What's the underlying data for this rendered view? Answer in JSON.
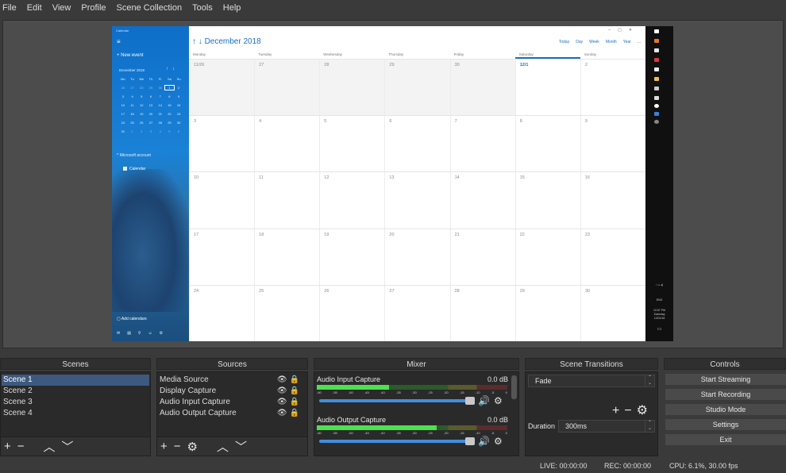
{
  "menu": [
    "File",
    "Edit",
    "View",
    "Profile",
    "Scene Collection",
    "Tools",
    "Help"
  ],
  "calendar": {
    "app_title": "Calendar",
    "new_event": "+  New event",
    "mini_month": "December 2018",
    "mini_days_header": [
      "Mo",
      "Tu",
      "We",
      "Th",
      "Fr",
      "Sa",
      "Su"
    ],
    "mini_days": [
      "26",
      "27",
      "28",
      "29",
      "30",
      "1",
      "2",
      "3",
      "4",
      "5",
      "6",
      "7",
      "8",
      "9",
      "10",
      "11",
      "12",
      "13",
      "14",
      "15",
      "16",
      "17",
      "18",
      "19",
      "20",
      "21",
      "22",
      "23",
      "24",
      "25",
      "26",
      "27",
      "28",
      "29",
      "30",
      "31",
      "1",
      "2",
      "3",
      "4",
      "5",
      "6"
    ],
    "account": "^  Microsoft account",
    "calendar_item": "Calendar",
    "add_calendars": "Add calendars",
    "month_title": "December 2018",
    "views": [
      "Today",
      "Day",
      "Week",
      "Month",
      "Year",
      "..."
    ],
    "day_headers": [
      "Monday",
      "Tuesday",
      "Wednesday",
      "Thursday",
      "Friday",
      "Saturday",
      "Sunday"
    ],
    "weeks": [
      [
        "11/26",
        "27",
        "28",
        "29",
        "30",
        "12/1",
        "2"
      ],
      [
        "3",
        "4",
        "5",
        "6",
        "7",
        "8",
        "9"
      ],
      [
        "10",
        "11",
        "12",
        "13",
        "14",
        "15",
        "16"
      ],
      [
        "17",
        "18",
        "19",
        "20",
        "21",
        "22",
        "23"
      ],
      [
        "24",
        "25",
        "26",
        "27",
        "28",
        "29",
        "30"
      ]
    ],
    "tray": {
      "lang": "ENG",
      "time": "10:57 PM",
      "day": "Saturday",
      "date": "12/01/18"
    }
  },
  "panels": {
    "scenes": {
      "title": "Scenes",
      "items": [
        "Scene 1",
        "Scene 2",
        "Scene 3",
        "Scene 4"
      ]
    },
    "sources": {
      "title": "Sources",
      "items": [
        "Media Source",
        "Display Capture",
        "Audio Input Capture",
        "Audio Output Capture"
      ]
    },
    "mixer": {
      "title": "Mixer",
      "channels": [
        {
          "name": "Audio Input Capture",
          "db": "0.0 dB",
          "level": 0.38
        },
        {
          "name": "Audio Output Capture",
          "db": "0.0 dB",
          "level": 0.63
        }
      ],
      "ticks": [
        "-60",
        "-55",
        "-50",
        "-45",
        "-40",
        "-35",
        "-30",
        "-25",
        "-20",
        "-15",
        "-10",
        "-5",
        "0"
      ]
    },
    "transitions": {
      "title": "Scene Transitions",
      "selected": "Fade",
      "duration_label": "Duration",
      "duration_value": "300ms"
    },
    "controls": {
      "title": "Controls",
      "buttons": [
        "Start Streaming",
        "Start Recording",
        "Studio Mode",
        "Settings",
        "Exit"
      ]
    }
  },
  "status": {
    "live": "LIVE: 00:00:00",
    "rec": "REC: 00:00:00",
    "cpu": "CPU: 6.1%, 30.00 fps"
  },
  "colors": {
    "accent": "#3c5a80",
    "calendar_blue": "#1c6fc3",
    "meter_green": "#4ee04e"
  }
}
